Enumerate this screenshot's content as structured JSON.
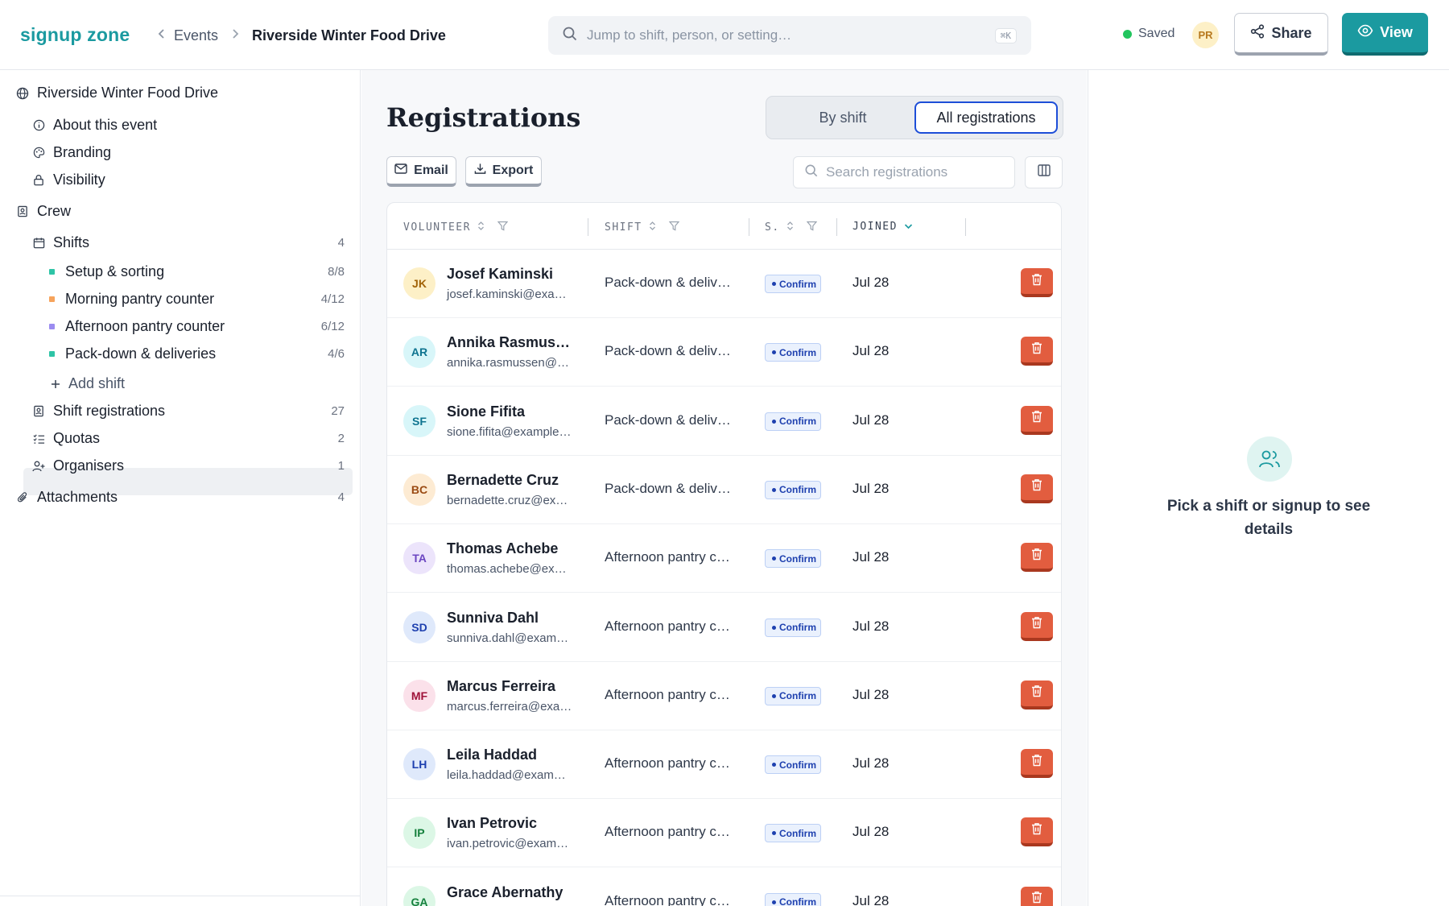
{
  "app": {
    "logo": "signup zone"
  },
  "breadcrumb": {
    "events": "Events",
    "current": "Riverside Winter Food Drive"
  },
  "global_search": {
    "placeholder": "Jump to shift, person, or setting…",
    "shortcut": "⌘K"
  },
  "status": {
    "saved": "Saved"
  },
  "user": {
    "initials": "PR"
  },
  "header_buttons": {
    "share": "Share",
    "view": "View"
  },
  "sidebar": {
    "event": "Riverside Winter Food Drive",
    "about": "About this event",
    "branding": "Branding",
    "visibility": "Visibility",
    "crew": "Crew",
    "shifts": {
      "label": "Shifts",
      "count": "4"
    },
    "shift_items": [
      {
        "label": "Setup & sorting",
        "count": "8/8",
        "color": "#2ec4a6"
      },
      {
        "label": "Morning pantry counter",
        "count": "4/12",
        "color": "#f6a35c"
      },
      {
        "label": "Afternoon pantry counter",
        "count": "6/12",
        "color": "#9b8cf0"
      },
      {
        "label": "Pack-down & deliveries",
        "count": "4/6",
        "color": "#2ec4a6"
      }
    ],
    "add_shift": "Add shift",
    "registrations": {
      "label": "Shift registrations",
      "count": "27"
    },
    "quotas": {
      "label": "Quotas",
      "count": "2"
    },
    "organisers": {
      "label": "Organisers",
      "count": "1"
    },
    "attachments": {
      "label": "Attachments",
      "count": "4"
    }
  },
  "main": {
    "title": "Registrations",
    "tabs": {
      "by_shift": "By shift",
      "all": "All registrations"
    },
    "toolbar": {
      "email": "Email",
      "export": "Export",
      "search_placeholder": "Search registrations"
    },
    "columns": {
      "volunteer": "VOLUNTEER",
      "shift": "SHIFT",
      "status": "S.",
      "joined": "JOINED"
    },
    "rows": [
      {
        "initials": "JK",
        "avatar_bg": "#fdf0c7",
        "avatar_fg": "#a16207",
        "name": "Josef Kaminski",
        "email": "josef.kaminski@exa…",
        "shift": "Pack-down & deliv…",
        "status": "Confirm",
        "joined": "Jul 28"
      },
      {
        "initials": "AR",
        "avatar_bg": "#d8f6f9",
        "avatar_fg": "#0e7490",
        "name": "Annika Rasmus…",
        "email": "annika.rasmussen@…",
        "shift": "Pack-down & deliv…",
        "status": "Confirm",
        "joined": "Jul 28"
      },
      {
        "initials": "SF",
        "avatar_bg": "#d8f6f9",
        "avatar_fg": "#0e7490",
        "name": "Sione Fifita",
        "email": "sione.fifita@example…",
        "shift": "Pack-down & deliv…",
        "status": "Confirm",
        "joined": "Jul 28"
      },
      {
        "initials": "BC",
        "avatar_bg": "#fdebd3",
        "avatar_fg": "#9a4a12",
        "name": "Bernadette Cruz",
        "email": "bernadette.cruz@ex…",
        "shift": "Pack-down & deliv…",
        "status": "Confirm",
        "joined": "Jul 28"
      },
      {
        "initials": "TA",
        "avatar_bg": "#ece4fb",
        "avatar_fg": "#6b46c1",
        "name": "Thomas Achebe",
        "email": "thomas.achebe@ex…",
        "shift": "Afternoon pantry c…",
        "status": "Confirm",
        "joined": "Jul 28"
      },
      {
        "initials": "SD",
        "avatar_bg": "#dfe9fb",
        "avatar_fg": "#1e40af",
        "name": "Sunniva Dahl",
        "email": "sunniva.dahl@exam…",
        "shift": "Afternoon pantry c…",
        "status": "Confirm",
        "joined": "Jul 28"
      },
      {
        "initials": "MF",
        "avatar_bg": "#fbe1ea",
        "avatar_fg": "#9f1239",
        "name": "Marcus Ferreira",
        "email": "marcus.ferreira@exa…",
        "shift": "Afternoon pantry c…",
        "status": "Confirm",
        "joined": "Jul 28"
      },
      {
        "initials": "LH",
        "avatar_bg": "#dfe9fb",
        "avatar_fg": "#1e40af",
        "name": "Leila Haddad",
        "email": "leila.haddad@exam…",
        "shift": "Afternoon pantry c…",
        "status": "Confirm",
        "joined": "Jul 28"
      },
      {
        "initials": "IP",
        "avatar_bg": "#dcf7e6",
        "avatar_fg": "#15803d",
        "name": "Ivan Petrovic",
        "email": "ivan.petrovic@exam…",
        "shift": "Afternoon pantry c…",
        "status": "Confirm",
        "joined": "Jul 28"
      },
      {
        "initials": "GA",
        "avatar_bg": "#dcf7e6",
        "avatar_fg": "#15803d",
        "name": "Grace Abernathy",
        "email": "",
        "shift": "Afternoon pantry c…",
        "status": "Confirm",
        "joined": "Jul 28"
      }
    ]
  },
  "detail_panel": {
    "empty_text": "Pick a shift or signup to see details"
  }
}
